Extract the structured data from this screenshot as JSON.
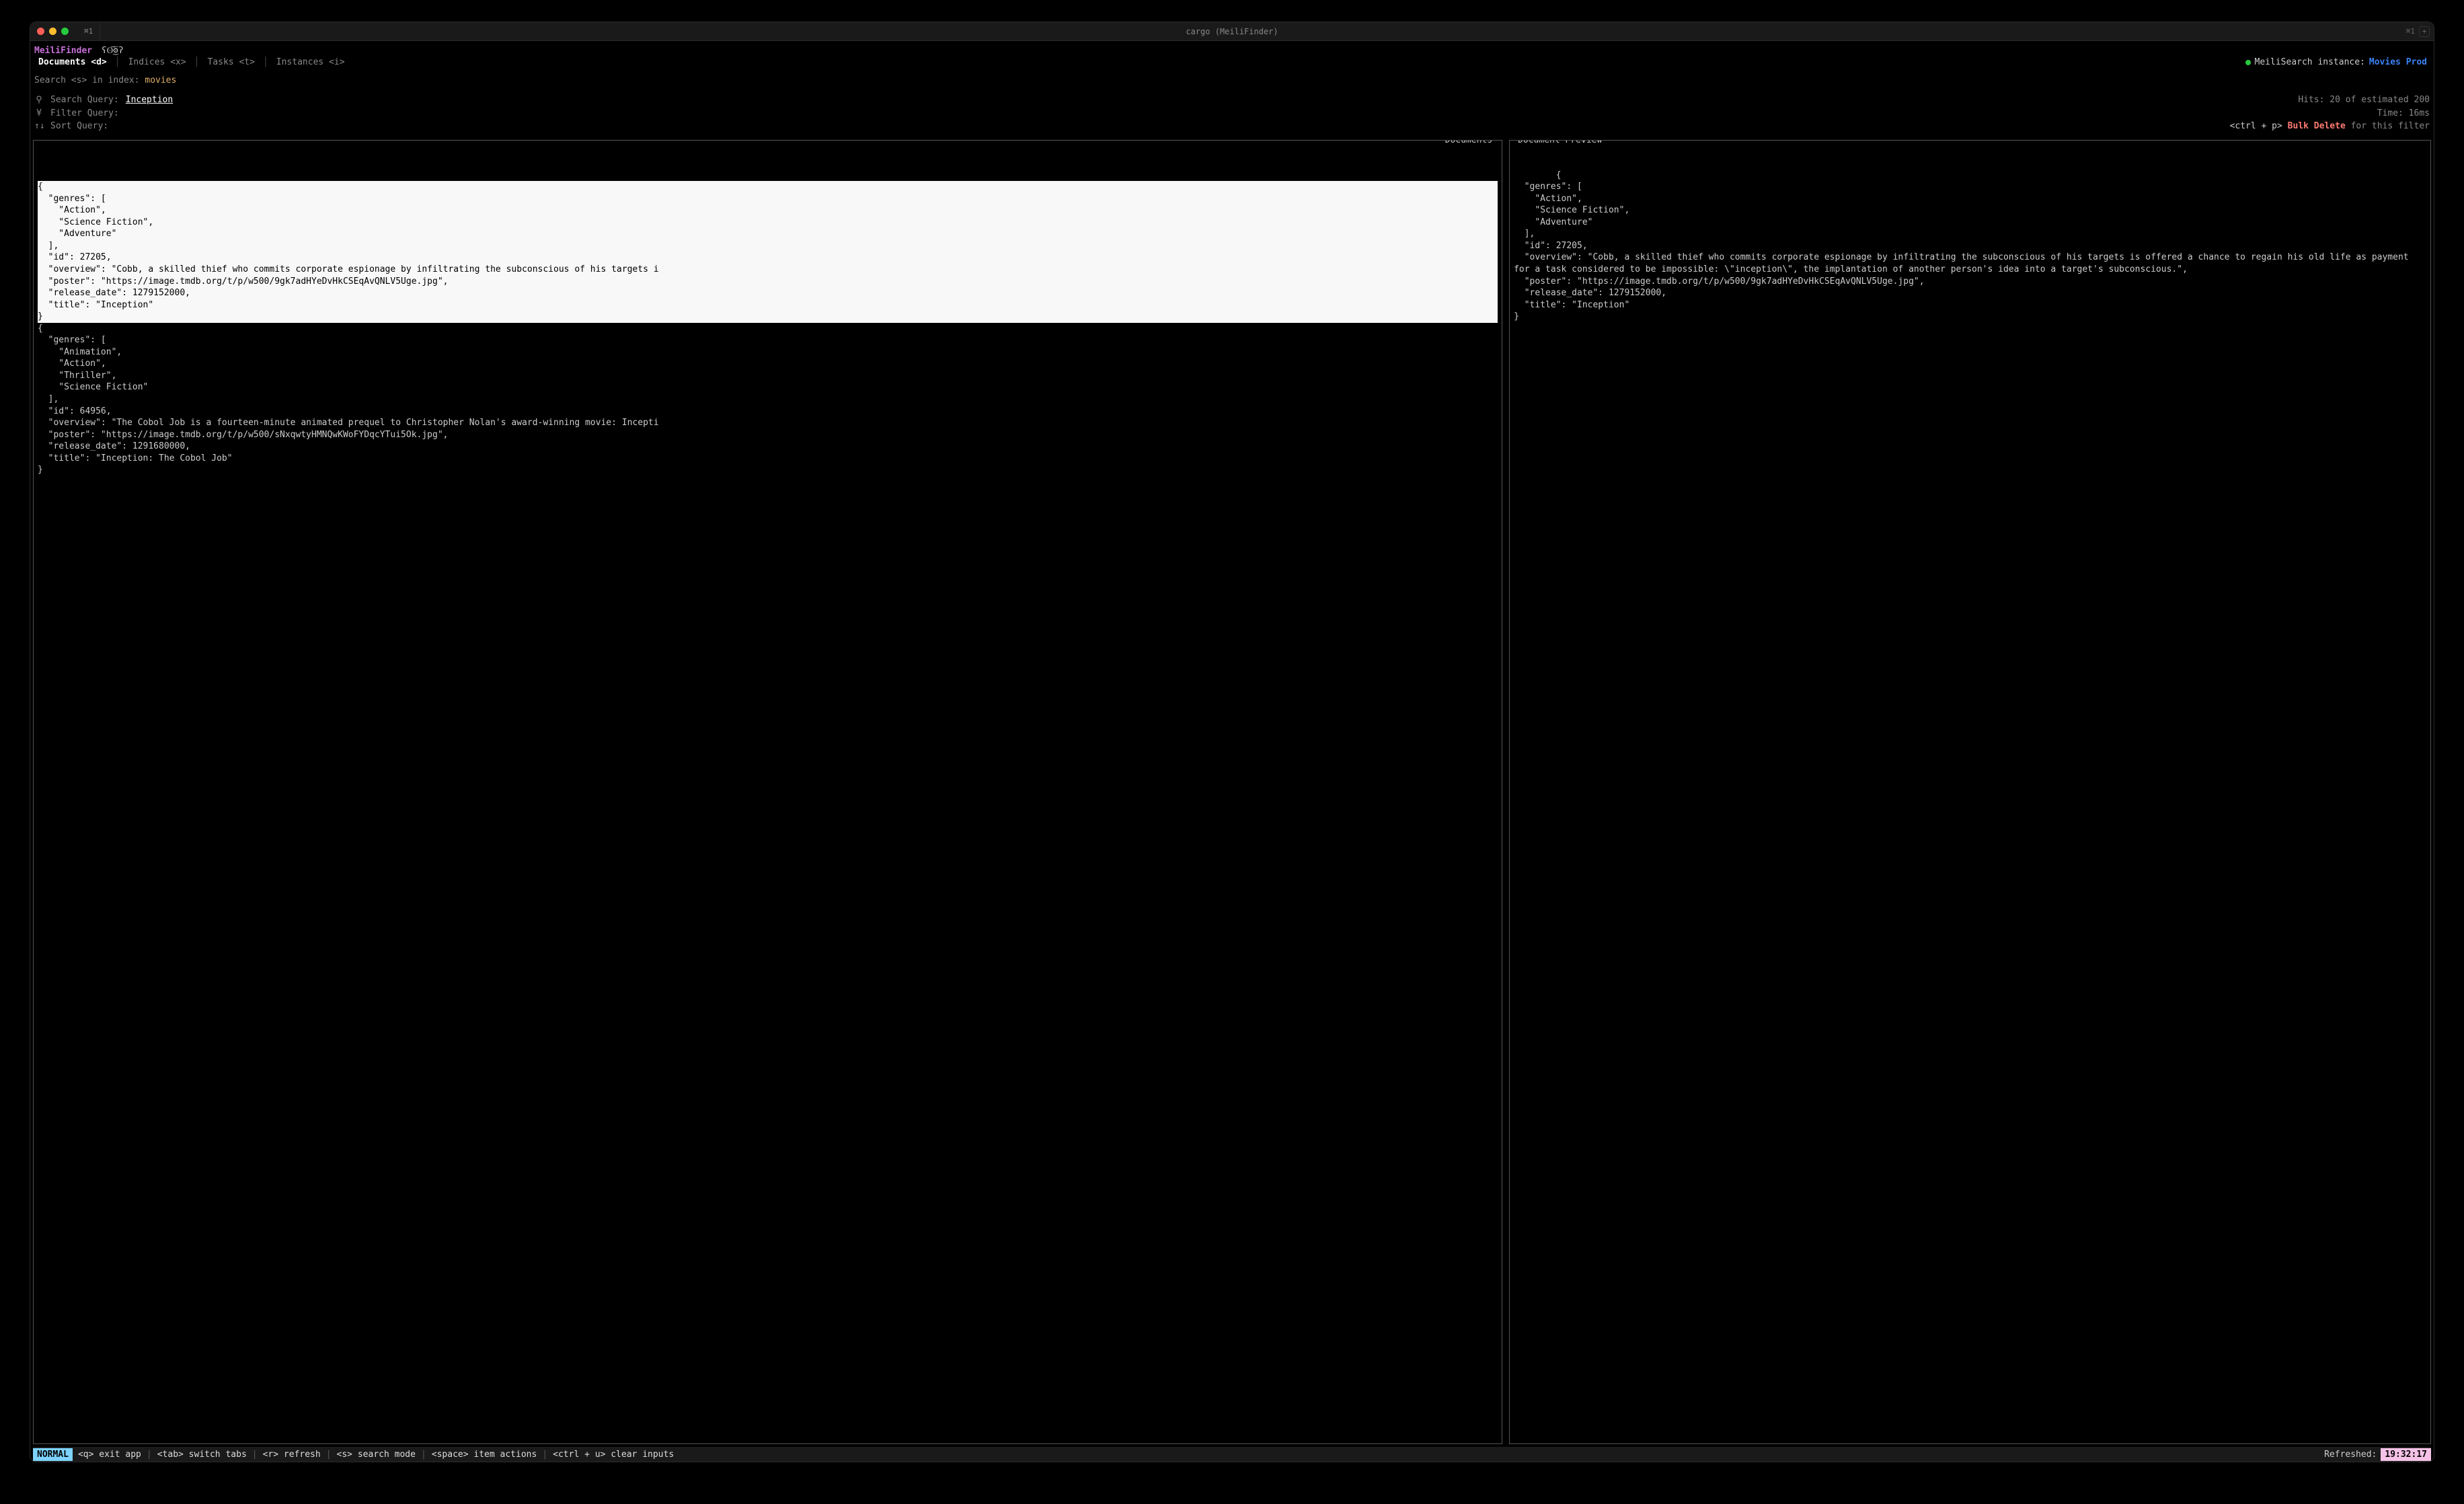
{
  "window": {
    "tab_label": "⌘1",
    "title": "cargo (MeiliFinder)",
    "right_shortcut": "⌘1",
    "new_tab": "+"
  },
  "brand": {
    "name": "MeiliFinder",
    "eyes": "ʕʘ̅͜ʘ̅ʔ"
  },
  "nav": {
    "documents": "Documents <d>",
    "indices": "Indices <x>",
    "tasks": "Tasks <t>",
    "instances": "Instances <i>"
  },
  "instance": {
    "label": "MeiliSearch instance:",
    "name": "Movies Prod"
  },
  "search_context": {
    "prefix": "Search <s> in index:",
    "index": "movies"
  },
  "queries": {
    "search": {
      "icon": "⚲",
      "label": "Search Query:",
      "value": "Inception"
    },
    "filter": {
      "icon": "¥",
      "label": "Filter Query:",
      "value": ""
    },
    "sort": {
      "icon": "↑↓",
      "label": "Sort Query:",
      "value": ""
    }
  },
  "stats": {
    "hits": "Hits: 20 of estimated 200",
    "time": "Time: 16ms",
    "bulk_key": "<ctrl + p>",
    "bulk_action": "Bulk Delete",
    "bulk_suffix": "for this filter"
  },
  "panels": {
    "docs_title": "Documents",
    "prev_title": "Document Preview"
  },
  "docs": {
    "selected": "{\n  \"genres\": [\n    \"Action\",\n    \"Science Fiction\",\n    \"Adventure\"\n  ],\n  \"id\": 27205,\n  \"overview\": \"Cobb, a skilled thief who commits corporate espionage by infiltrating the subconscious of his targets i\n  \"poster\": \"https://image.tmdb.org/t/p/w500/9gk7adHYeDvHkCSEqAvQNLV5Uge.jpg\",\n  \"release_date\": 1279152000,\n  \"title\": \"Inception\"\n}",
    "second": "{\n  \"genres\": [\n    \"Animation\",\n    \"Action\",\n    \"Thriller\",\n    \"Science Fiction\"\n  ],\n  \"id\": 64956,\n  \"overview\": \"The Cobol Job is a fourteen-minute animated prequel to Christopher Nolan's award-winning movie: Incepti\n  \"poster\": \"https://image.tmdb.org/t/p/w500/sNxqwtyHMNQwKWoFYDqcYTui5Ok.jpg\",\n  \"release_date\": 1291680000,\n  \"title\": \"Inception: The Cobol Job\"\n}"
  },
  "preview": "{\n  \"genres\": [\n    \"Action\",\n    \"Science Fiction\",\n    \"Adventure\"\n  ],\n  \"id\": 27205,\n  \"overview\": \"Cobb, a skilled thief who commits corporate espionage by infiltrating the subconscious of his targets is offered a chance to regain his old life as payment for a task considered to be impossible: \\\"inception\\\", the implantation of another person's idea into a target's subconscious.\",\n  \"poster\": \"https://image.tmdb.org/t/p/w500/9gk7adHYeDvHkCSEqAvQNLV5Uge.jpg\",\n  \"release_date\": 1279152000,\n  \"title\": \"Inception\"\n}",
  "statusbar": {
    "mode": "NORMAL",
    "exit": "<q> exit app",
    "switch": "<tab> switch tabs",
    "refresh": "<r> refresh",
    "search": "<s> search mode",
    "actions": "<space> item actions",
    "clear": "<ctrl + u> clear inputs",
    "refreshed_label": "Refreshed:",
    "refreshed_time": "19:32:17"
  }
}
